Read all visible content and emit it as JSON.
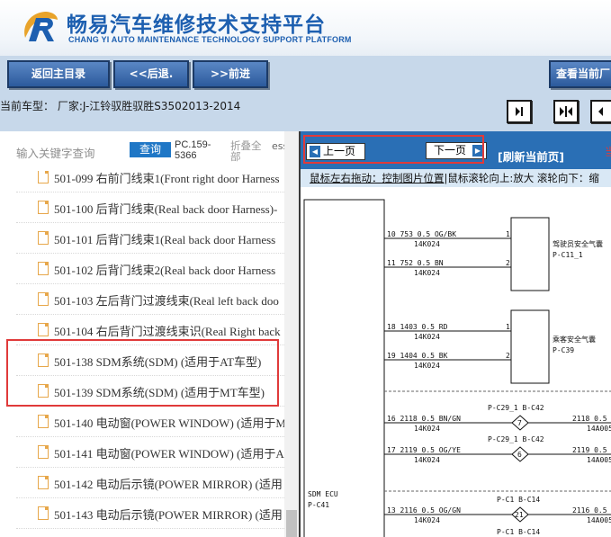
{
  "header": {
    "title_cn": "畅易汽车维修技术支持平台",
    "title_en": "CHANG YI AUTO MAINTENANCE TECHNOLOGY SUPPORT PLATFORM",
    "logo_color": "#1d5fb0",
    "logo_accent": "#e8a32b"
  },
  "nav": {
    "home": "返回主目录",
    "back": "<<后退.",
    "forward": ">>前进",
    "view_current": "查看当前厂"
  },
  "model": {
    "text": "当前车型：  厂家:J-江铃驭胜驭胜S3502013-2014"
  },
  "search": {
    "hint": "输入关键字查询",
    "button": "查询",
    "pc_code": "PC.159-5366",
    "fold": "折叠全部",
    "ess": "ess"
  },
  "docs": [
    "501-099 右前门线束1(Front right door Harness",
    "501-100 后背门线束(Real back door Harness)-",
    "501-101 后背门线束1(Real back door Harness",
    "501-102 后背门线束2(Real back door Harness",
    "501-103 左后背门过渡线束(Real left back doo",
    "501-104 右后背门过渡线束识(Real Right back",
    "501-138 SDM系统(SDM) (适用于AT车型)",
    "501-139 SDM系统(SDM) (适用于MT车型)",
    "501-140 电动窗(POWER WINDOW) (适用于M",
    "501-141 电动窗(POWER WINDOW) (适用于A",
    "501-142 电动后示镜(POWER MIRROR) (适用",
    "501-143 电动后示镜(POWER MIRROR) (适用"
  ],
  "pager": {
    "prev": "上一页",
    "next": "下一页",
    "refresh": "[刷新当前页]",
    "current": "当"
  },
  "hint": {
    "drag": "鼠标左右拖动：控制图片位置",
    "rest": "|鼠标滚轮向上:放大  滚轮向下：缩"
  },
  "diagram": {
    "wires": [
      {
        "label": "10  753  0.5  OG/BK",
        "code": "14K024",
        "pin": "1"
      },
      {
        "label": "11   752  0.5  BN",
        "code": "14K024",
        "pin": "2"
      },
      {
        "label": "18   1403  0.5  RD",
        "code": "14K024",
        "pin": "1"
      },
      {
        "label": "19   1404  0.5  BK",
        "code": "14K024",
        "pin": "2"
      },
      {
        "label": "16  2118  0.5  BN/GN",
        "code": "14K024"
      },
      {
        "label": "17  2119  0.5  OG/YE",
        "code": "14K024"
      },
      {
        "label": "13  2116  0.5  OG/GN",
        "code": "14K024"
      }
    ],
    "components": [
      {
        "name": "驾驶员安全气囊",
        "connector": "P-C11_1"
      },
      {
        "name": "乘客安全气囊",
        "connector": "P-C39"
      }
    ],
    "splices": [
      {
        "connectors": "P-C29_1  B-C42",
        "number": "7",
        "right_label": "2118  0.5  B",
        "right_code": "14A005"
      },
      {
        "connectors": "P-C29_1  B-C42",
        "number": "6",
        "right_label": "2119  0.5  O",
        "right_code": "14A005"
      },
      {
        "connectors": "P-C1   B-C14",
        "number": "21",
        "right_label": "2116  0.5  O",
        "right_code": "14A005"
      },
      {
        "connectors": "P-C1   B-C14",
        "number": ""
      }
    ],
    "ecu": {
      "name": "SDM ECU",
      "connector": "P-C41"
    }
  }
}
